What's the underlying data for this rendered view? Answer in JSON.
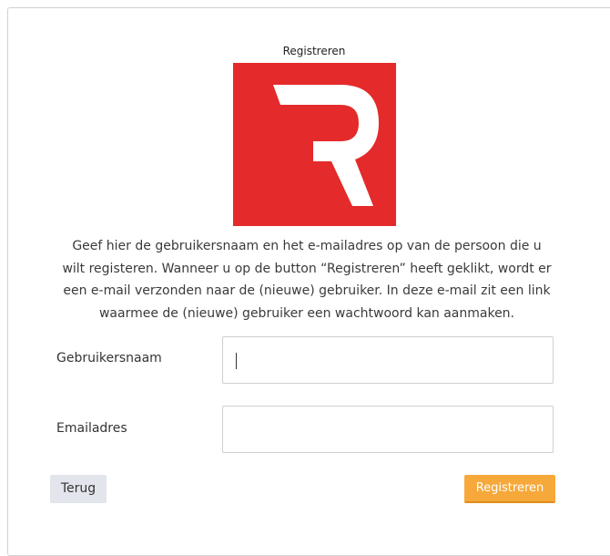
{
  "form": {
    "title": "Registreren",
    "logo_letter": "R",
    "intro_lines": [
      "Geef hier de gebruikersnaam en het e-mailadres op van de persoon die u",
      "wilt registeren. Wanneer u op de button “Registreren” heeft geklikt, wordt er",
      "een e-mail verzonden naar de (nieuwe) gebruiker. In deze e-mail zit een link",
      "waarmee de (nieuwe) gebruiker een wachtwoord kan aanmaken."
    ],
    "username_label": "Gebruikersnaam",
    "username_value": "",
    "email_label": "Emailadres",
    "email_value": "",
    "back_label": "Terug",
    "submit_label": "Registreren"
  },
  "colors": {
    "logo_background": "#e42a2a",
    "submit_button": "#f6a83a",
    "back_button": "#e3e5ec"
  },
  "icons": {
    "logo": "r-logo-icon"
  }
}
